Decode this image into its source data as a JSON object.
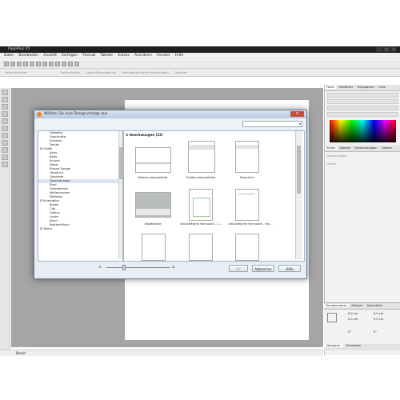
{
  "app": {
    "window_title": "PagePlus X5",
    "menu": [
      "Datei",
      "Bearbeiten",
      "Ansicht",
      "Einfügen",
      "Format",
      "Tabelle",
      "Extras",
      "Anordnen",
      "Fenster",
      "Hilfe"
    ],
    "toolbar2": [
      "Seite einrichten",
      "Seiten fließen",
      "Layoutführungen(ca)",
      "Benutzerdefinierte Hochbelegen",
      "Optionen"
    ],
    "status": "Bereit"
  },
  "right_panel": {
    "tabs1": [
      "Farbe",
      "Farbfelder",
      "Transparenz",
      "Linie"
    ],
    "tabs2": [
      "Seiten",
      "Ebenen",
      "Formatvorlagen",
      "Galerie"
    ],
    "master_label": "Master-Seiten",
    "pages_label": "Seiten",
    "transform_tabs": [
      "Transformieren",
      "Zeichen",
      "Ausrichten"
    ],
    "transform_values": [
      "0,0 cm",
      "0,0 cm",
      "0,0 cm",
      "0,0 cm",
      "0°",
      "0°"
    ],
    "nav_tabs": [
      "Navigator",
      "Schemata"
    ]
  },
  "dialog": {
    "title": "Wählen Sie eine Designvorlage aus",
    "gallery_header": "Geschwungen (22)",
    "tree": [
      {
        "label": "Trabanta",
        "level": "sub"
      },
      {
        "label": "Geschnittg",
        "level": "sub"
      },
      {
        "label": "Schmalz",
        "level": "sub"
      },
      {
        "label": "Trendy",
        "level": "sub"
      },
      {
        "label": "Grafik",
        "level": "cat"
      },
      {
        "label": "Aktiv",
        "level": "sub"
      },
      {
        "label": "Bella",
        "level": "sub"
      },
      {
        "label": "Kurven",
        "level": "sub"
      },
      {
        "label": "Decor",
        "level": "sub"
      },
      {
        "label": "Blaues Design",
        "level": "sub"
      },
      {
        "label": "Herbfrich",
        "level": "sub"
      },
      {
        "label": "Quadrate",
        "level": "sub"
      },
      {
        "label": "Geschwungen",
        "level": "sub",
        "selected": true
      },
      {
        "label": "Pixel",
        "level": "sub"
      },
      {
        "label": "Geometrisch",
        "level": "sub"
      },
      {
        "label": "Wellenmuster",
        "level": "sub"
      },
      {
        "label": "Wellness",
        "level": "sub"
      },
      {
        "label": "Illustration",
        "level": "cat"
      },
      {
        "label": "Boxen",
        "level": "sub"
      },
      {
        "label": "City",
        "level": "sub"
      },
      {
        "label": "Globus",
        "level": "sub"
      },
      {
        "label": "Linien",
        "level": "sub"
      },
      {
        "label": "Stern",
        "level": "sub"
      },
      {
        "label": "Postkartillioni",
        "level": "sub"
      },
      {
        "label": "Textur",
        "level": "cat"
      }
    ],
    "captions": [
      "Kleines Adressetikett",
      "Großes Adressetikett",
      "Broschüre",
      "Visitenkarte",
      "Geschäftliche Formulare - C...",
      "Geschäftliche Formulare - Fax..."
    ],
    "buttons": {
      "ok": "OK",
      "cancel": "Abbrechen",
      "help": "Hilfe"
    }
  }
}
